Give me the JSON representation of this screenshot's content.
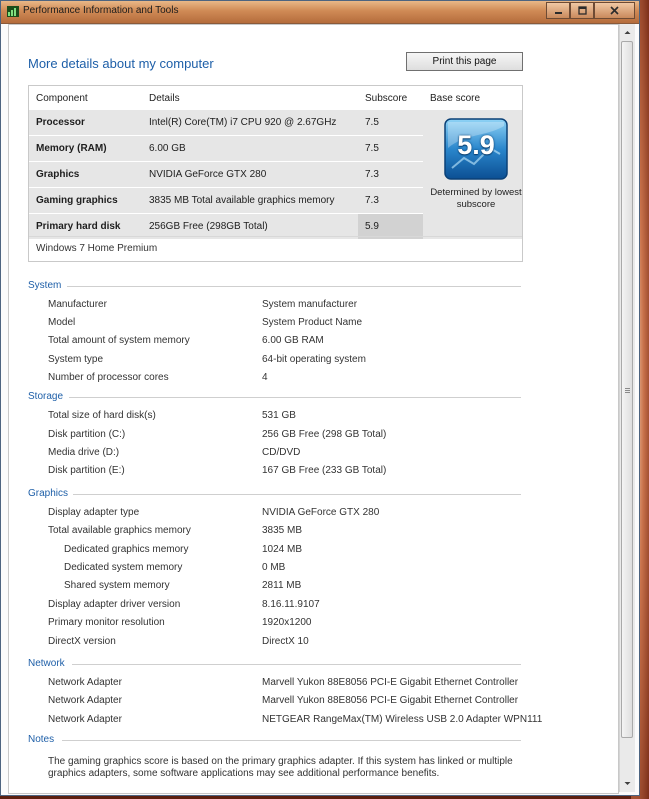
{
  "window": {
    "title": "Performance Information and Tools",
    "icon": "perf-tools-icon"
  },
  "page": {
    "heading": "More details about my computer",
    "print_label": "Print this page"
  },
  "score_table": {
    "headers": [
      "Component",
      "Details",
      "Subscore",
      "Base score"
    ],
    "rows": [
      {
        "component": "Processor",
        "details": "Intel(R) Core(TM) i7 CPU 920 @ 2.67GHz",
        "subscore": "7.5"
      },
      {
        "component": "Memory (RAM)",
        "details": "6.00 GB",
        "subscore": "7.5"
      },
      {
        "component": "Graphics",
        "details": "NVIDIA GeForce GTX 280",
        "subscore": "7.3"
      },
      {
        "component": "Gaming graphics",
        "details": "3835 MB Total available graphics memory",
        "subscore": "7.3"
      },
      {
        "component": "Primary hard disk",
        "details": "256GB Free (298GB Total)",
        "subscore": "5.9"
      }
    ],
    "base_score": "5.9",
    "base_note": "Determined by lowest subscore",
    "edition": "Windows 7 Home Premium"
  },
  "sections": {
    "system": {
      "title": "System",
      "items": [
        {
          "label": "Manufacturer",
          "value": "System manufacturer"
        },
        {
          "label": "Model",
          "value": "System Product Name"
        },
        {
          "label": "Total amount of system memory",
          "value": "6.00 GB RAM"
        },
        {
          "label": "System type",
          "value": "64-bit operating system"
        },
        {
          "label": "Number of processor cores",
          "value": "4"
        }
      ]
    },
    "storage": {
      "title": "Storage",
      "items": [
        {
          "label": "Total size of hard disk(s)",
          "value": "531 GB"
        },
        {
          "label": "Disk partition (C:)",
          "value": "256 GB Free (298 GB Total)"
        },
        {
          "label": "Media drive (D:)",
          "value": "CD/DVD"
        },
        {
          "label": "Disk partition (E:)",
          "value": "167 GB Free (233 GB Total)"
        }
      ]
    },
    "graphics": {
      "title": "Graphics",
      "items": [
        {
          "label": "Display adapter type",
          "value": "NVIDIA GeForce GTX 280"
        },
        {
          "label": "Total available graphics memory",
          "value": "3835 MB"
        },
        {
          "label": "Dedicated graphics memory",
          "value": "1024 MB"
        },
        {
          "label": "Dedicated system memory",
          "value": "0 MB"
        },
        {
          "label": "Shared system memory",
          "value": "2811 MB"
        },
        {
          "label": "Display adapter driver version",
          "value": "8.16.11.9107"
        },
        {
          "label": "Primary monitor resolution",
          "value": "1920x1200"
        },
        {
          "label": "DirectX version",
          "value": "DirectX 10"
        }
      ]
    },
    "network": {
      "title": "Network",
      "items": [
        {
          "label": "Network Adapter",
          "value": "Marvell Yukon 88E8056 PCI-E Gigabit Ethernet Controller"
        },
        {
          "label": "Network Adapter",
          "value": "Marvell Yukon 88E8056 PCI-E Gigabit Ethernet Controller"
        },
        {
          "label": "Network Adapter",
          "value": "NETGEAR RangeMax(TM) Wireless USB 2.0 Adapter WPN111"
        }
      ]
    },
    "notes": {
      "title": "Notes",
      "text": "The gaming graphics score is based on the primary graphics adapter. If this system has linked or multiple graphics adapters, some software applications may see additional performance benefits."
    }
  },
  "colors": {
    "heading_blue": "#1e5fa8",
    "row_gray": "#e6e6e6"
  }
}
